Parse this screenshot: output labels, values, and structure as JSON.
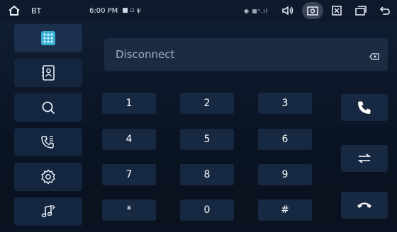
{
  "statusbar": {
    "app_label": "BT",
    "time": "6:00 PM"
  },
  "dialer": {
    "display_text": "Disconnect",
    "keys": [
      "1",
      "2",
      "3",
      "4",
      "5",
      "6",
      "7",
      "8",
      "9",
      "*",
      "0",
      "#"
    ]
  },
  "sidebar": {
    "items": [
      {
        "id": "dialpad",
        "icon": "dialpad-icon"
      },
      {
        "id": "contacts",
        "icon": "contacts-icon"
      },
      {
        "id": "search",
        "icon": "search-icon"
      },
      {
        "id": "call-log",
        "icon": "call-log-icon"
      },
      {
        "id": "settings",
        "icon": "gear-icon"
      },
      {
        "id": "music",
        "icon": "music-icon"
      }
    ]
  },
  "actions": [
    "phone-call-icon",
    "switch-audio-icon",
    "hang-up-icon"
  ],
  "colors": {
    "accent": "#3ab0d6",
    "background": "#0b1424",
    "button": "#172842"
  }
}
